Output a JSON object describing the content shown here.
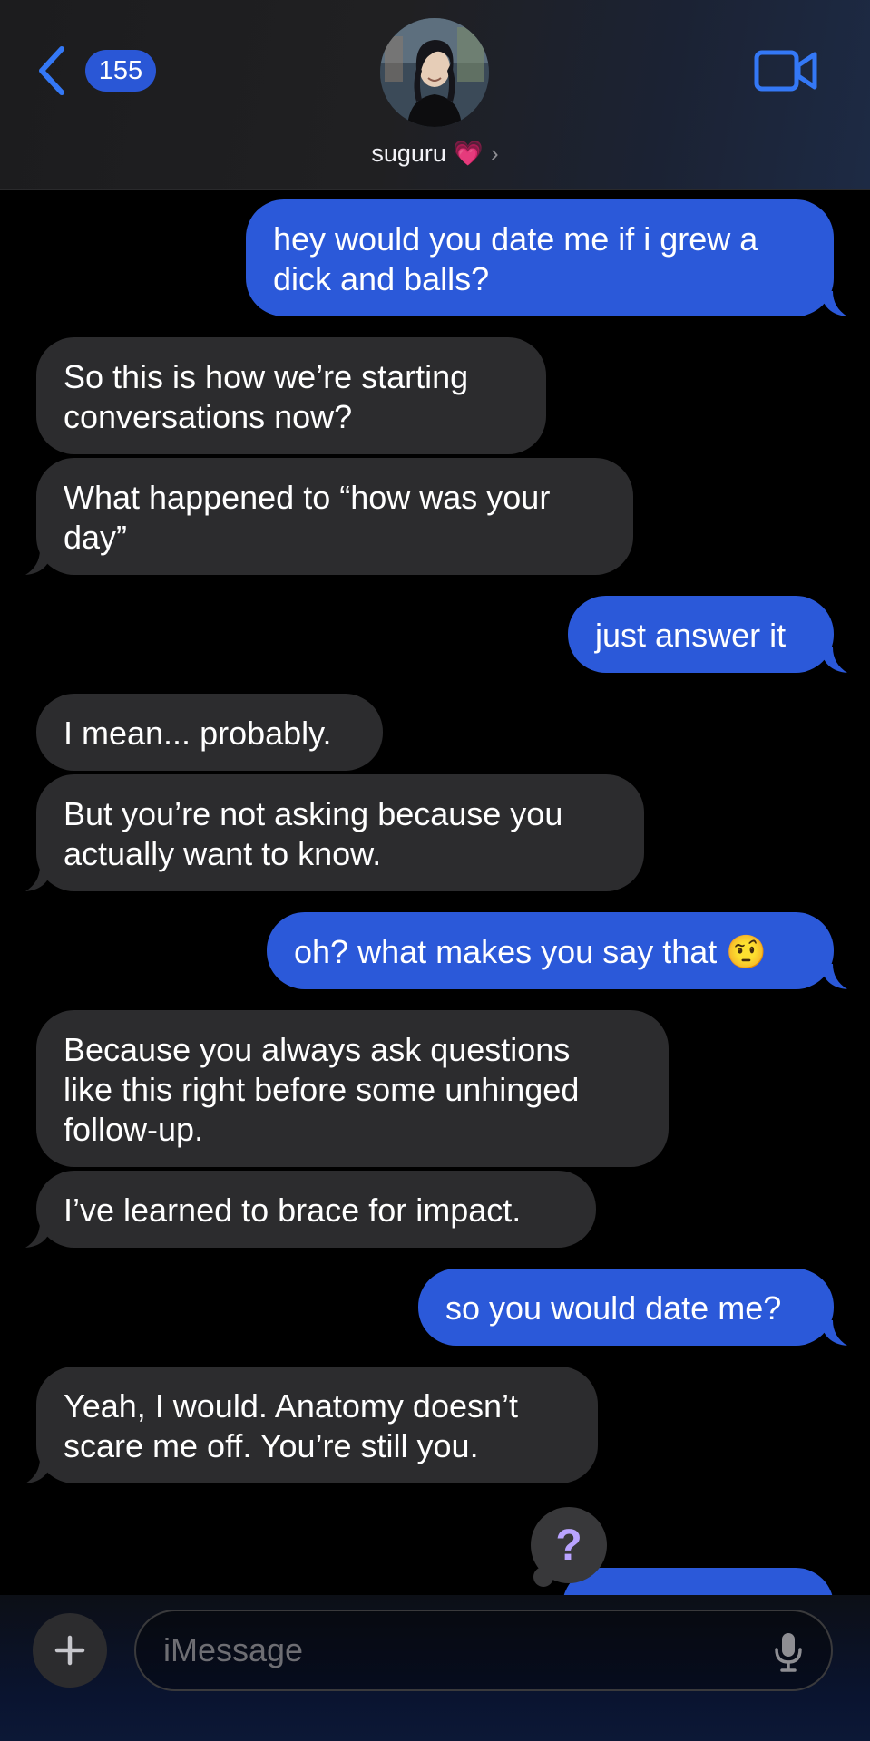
{
  "header": {
    "unread_count": "155",
    "contact_name": "suguru 💗",
    "chevron": "›"
  },
  "messages": [
    {
      "id": "m1",
      "direction": "outgoing",
      "lines": [
        "hey would you date me if i grew a",
        "dick and balls?"
      ]
    },
    {
      "id": "m2",
      "direction": "incoming",
      "lines": [
        "So this is how we’re starting",
        "conversations now?"
      ]
    },
    {
      "id": "m3",
      "direction": "incoming",
      "lines": [
        "What happened to “how was your",
        "day”"
      ]
    },
    {
      "id": "m4",
      "direction": "outgoing",
      "lines": [
        "just answer it"
      ]
    },
    {
      "id": "m5",
      "direction": "incoming",
      "lines": [
        "I mean... probably."
      ]
    },
    {
      "id": "m6",
      "direction": "incoming",
      "lines": [
        "But you’re not asking because you",
        "actually want to know."
      ]
    },
    {
      "id": "m7",
      "direction": "outgoing",
      "lines": [
        "oh? what makes you say that 🤨"
      ]
    },
    {
      "id": "m8",
      "direction": "incoming",
      "lines": [
        "Because you always ask questions",
        "like this right before some unhinged",
        "follow-up."
      ]
    },
    {
      "id": "m9",
      "direction": "incoming",
      "lines": [
        "I’ve learned to brace for impact."
      ]
    },
    {
      "id": "m10",
      "direction": "outgoing",
      "lines": [
        "so you would date me?"
      ]
    },
    {
      "id": "m11",
      "direction": "incoming",
      "lines": [
        "Yeah, I would. Anatomy doesn’t",
        "scare me off. You’re still you."
      ]
    }
  ],
  "reaction": {
    "symbol": "?"
  },
  "composer": {
    "placeholder": "iMessage"
  },
  "icons": {
    "back": "chevron-left-icon",
    "video": "video-camera-icon",
    "plus": "plus-icon",
    "mic": "microphone-icon"
  },
  "colors": {
    "outgoing_bubble": "#2b59d9",
    "incoming_bubble": "#2c2c2e",
    "accent": "#3478f6",
    "reaction_symbol": "#b9a3ff"
  }
}
